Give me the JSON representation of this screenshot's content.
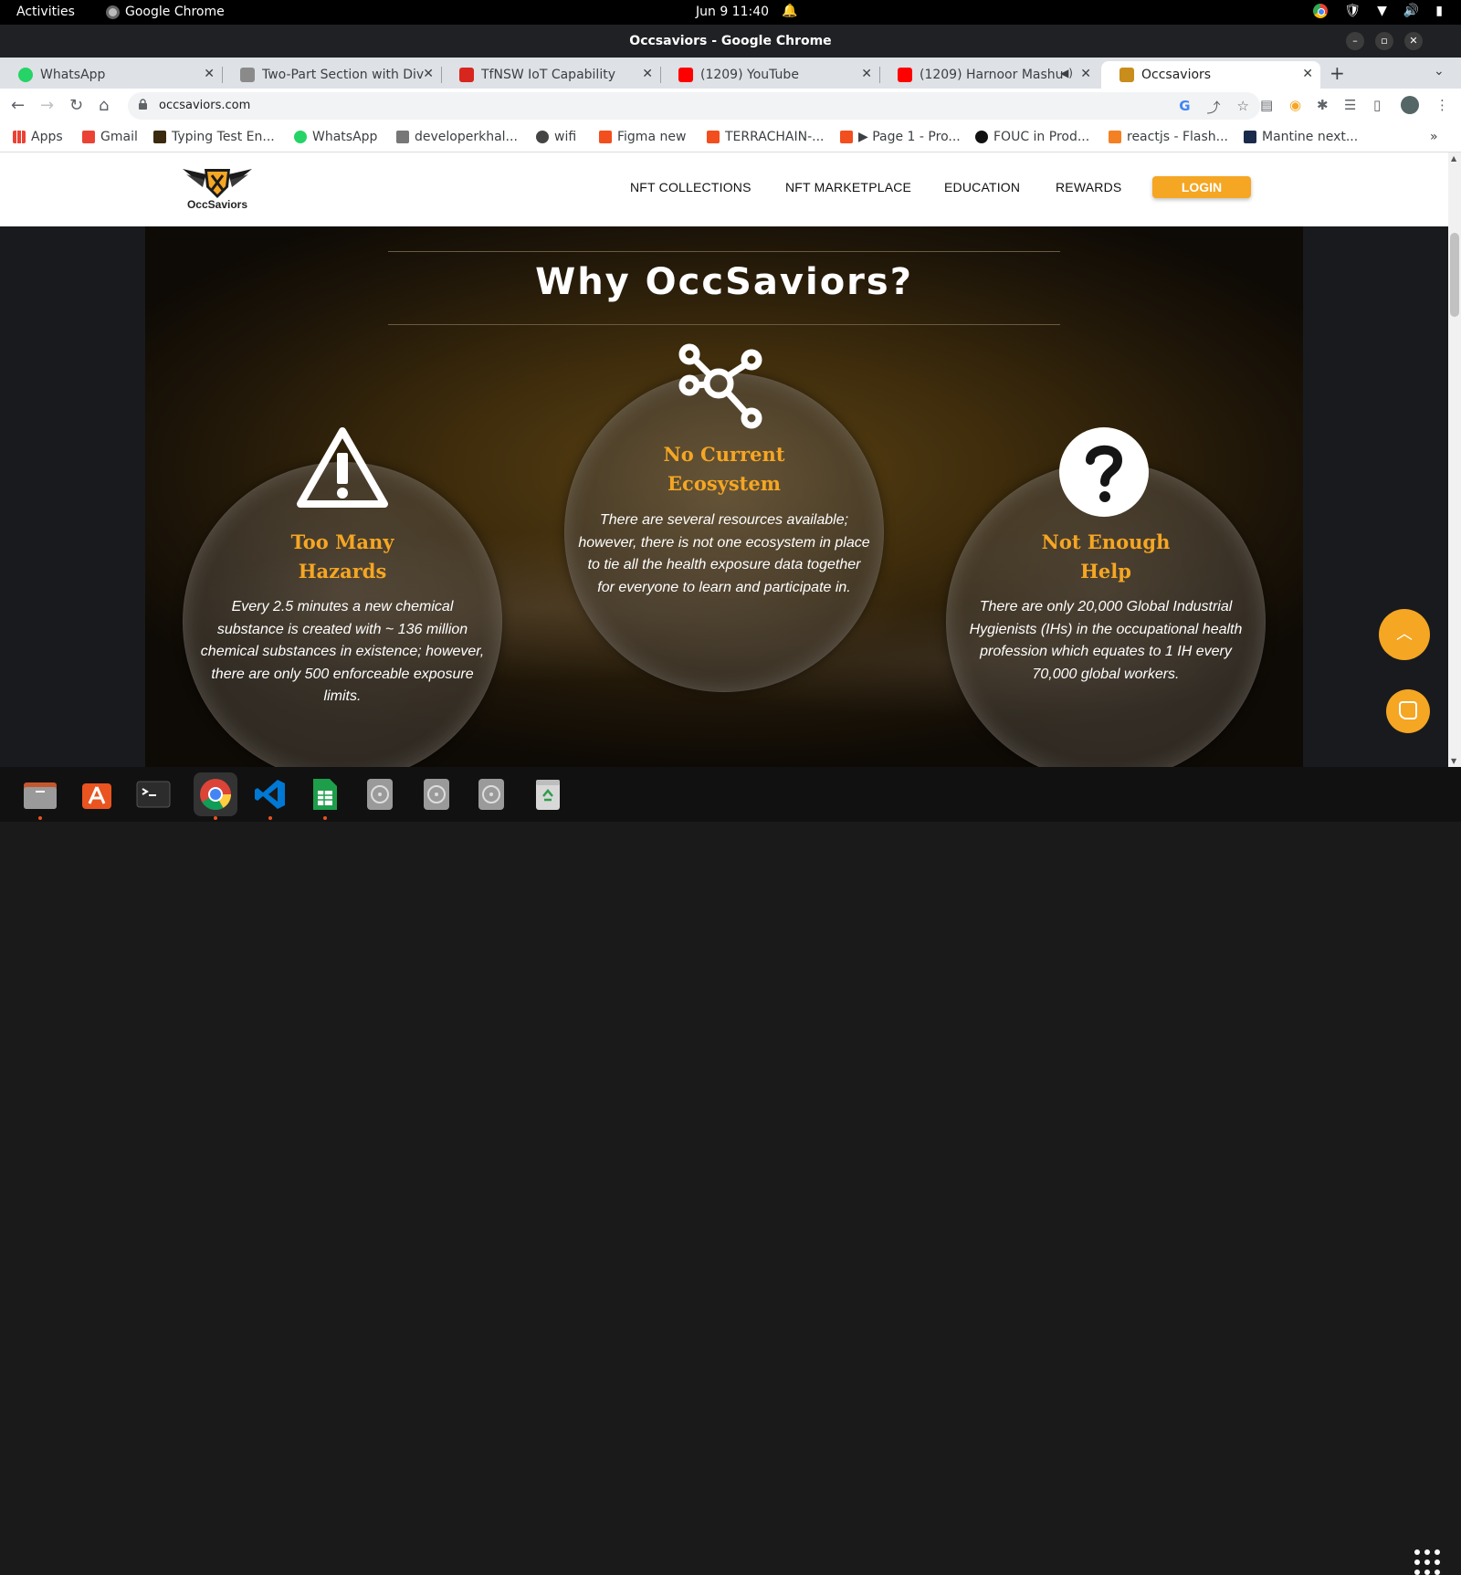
{
  "topbar": {
    "activities": "Activities",
    "app_name": "Google Chrome",
    "clock": "Jun 9  11:40"
  },
  "window": {
    "title": "Occsaviors - Google Chrome"
  },
  "tabs": [
    {
      "label": "WhatsApp",
      "favicon_color": "#25d366"
    },
    {
      "label": "Two-Part Section with Div",
      "favicon_color": "#8a8a8a"
    },
    {
      "label": "TfNSW IoT Capability",
      "favicon_color": "#d7261e"
    },
    {
      "label": "(1209) YouTube",
      "favicon_color": "#ff0000"
    },
    {
      "label": "(1209) Harnoor Mashu",
      "favicon_color": "#ff0000"
    },
    {
      "label": "Occsaviors",
      "favicon_color": "#c98d1c"
    }
  ],
  "toolbar": {
    "url": "occsaviors.com"
  },
  "bookmarks": [
    {
      "label": "Apps",
      "color": "#ea4335"
    },
    {
      "label": "Gmail",
      "color": "#ea4335"
    },
    {
      "label": "Typing Test En...",
      "color": "#3b2a10"
    },
    {
      "label": "WhatsApp",
      "color": "#25d366"
    },
    {
      "label": "developerkhal...",
      "color": "#777777"
    },
    {
      "label": "wifi",
      "color": "#444444"
    },
    {
      "label": "Figma new",
      "color": "#f24e1e"
    },
    {
      "label": "TERRACHAIN-...",
      "color": "#f24e1e"
    },
    {
      "label": "▶ Page 1 - Pro...",
      "color": "#f24e1e"
    },
    {
      "label": "FOUC in Prod...",
      "color": "#111111"
    },
    {
      "label": "reactjs - Flash...",
      "color": "#f48024"
    },
    {
      "label": "Mantine next...",
      "color": "#1a2a4a"
    }
  ],
  "site": {
    "brand": "OccSaviors",
    "nav": [
      "NFT COLLECTIONS",
      "NFT MARKETPLACE",
      "EDUCATION",
      "REWARDS"
    ],
    "login": "LOGIN",
    "section_title": "Why OccSaviors?",
    "accent": "#f5a623",
    "cards": [
      {
        "icon": "warning-triangle-icon",
        "title_line1": "Too Many",
        "title_line2": "Hazards",
        "text": "Every 2.5 minutes a new chemical substance is created with ~ 136 million chemical substances in existence; however, there are only 500 enforceable exposure limits."
      },
      {
        "icon": "network-nodes-icon",
        "title_line1": "No Current",
        "title_line2": "Ecosystem",
        "text": "There are several resources available; however, there is not one ecosystem in place to tie all the health exposure data together for everyone to learn and participate in."
      },
      {
        "icon": "question-mark-icon",
        "title_line1": "Not Enough",
        "title_line2": "Help",
        "text": "There are only 20,000 Global Industrial Hygienists (IHs) in the occupational health profession which equates to 1 IH every 70,000 global workers."
      }
    ]
  }
}
